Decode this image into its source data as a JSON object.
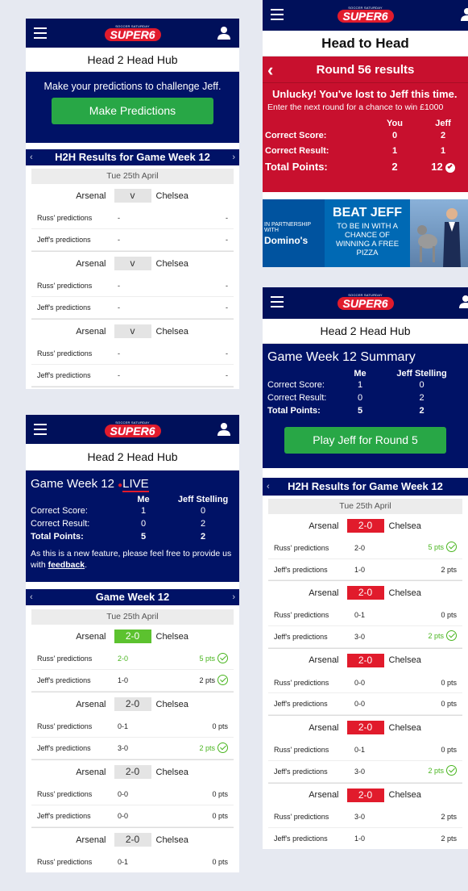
{
  "logo": {
    "small": "SOCCER SATURDAY",
    "big": "SUPER6"
  },
  "colors": {
    "navy": "#00105a",
    "red": "#e11b2c",
    "green": "#28a746",
    "win": "#5cc22f"
  },
  "icons": {
    "menu": "hamburger-menu-icon",
    "user": "user-icon",
    "back": "chevron-left-icon",
    "next": "chevron-right-icon",
    "check": "check-circle-icon"
  },
  "s1": {
    "title": "Head 2 Head Hub",
    "message": "Make your predictions to challenge Jeff.",
    "button": "Make Predictions",
    "bar": "H2H Results for Game Week 12",
    "date": "Tue 25th April",
    "matches": [
      {
        "home": "Arsenal",
        "score": "v",
        "away": "Chelsea",
        "rows": [
          {
            "name": "Russ' predictions",
            "score": "-",
            "pts": "-"
          },
          {
            "name": "Jeff's predictions",
            "score": "-",
            "pts": "-"
          }
        ]
      },
      {
        "home": "Arsenal",
        "score": "v",
        "away": "Chelsea",
        "rows": [
          {
            "name": "Russ' predictions",
            "score": "-",
            "pts": "-"
          },
          {
            "name": "Jeff's predictions",
            "score": "-",
            "pts": "-"
          }
        ]
      },
      {
        "home": "Arsenal",
        "score": "v",
        "away": "Chelsea",
        "rows": [
          {
            "name": "Russ' predictions",
            "score": "-",
            "pts": "-"
          },
          {
            "name": "Jeff's predictions",
            "score": "-",
            "pts": "-"
          }
        ]
      }
    ]
  },
  "s2": {
    "title": "Head 2 Head Hub",
    "gw": "Game Week 12",
    "live": "LIVE",
    "colMe": "Me",
    "colJeff": "Jeff Stelling",
    "rows": [
      {
        "label": "Correct Score:",
        "me": "1",
        "jeff": "0"
      },
      {
        "label": "Correct Result:",
        "me": "0",
        "jeff": "2"
      },
      {
        "label": "Total Points:",
        "me": "5",
        "jeff": "2"
      }
    ],
    "note": "As this is a new feature, please feel free to provide us with",
    "feedback": "feedback",
    "bar": "Game Week 12",
    "date": "Tue 25th April",
    "matches": [
      {
        "home": "Arsenal",
        "score": "2-0",
        "away": "Chelsea",
        "rows": [
          {
            "name": "Russ' predictions",
            "score": "2-0",
            "pts": "5 pts",
            "win": true
          },
          {
            "name": "Jeff's predictions",
            "score": "1-0",
            "pts": "2 pts",
            "win": false,
            "check": true
          }
        ]
      },
      {
        "home": "Arsenal",
        "score": "2-0",
        "away": "Chelsea",
        "rows": [
          {
            "name": "Russ' predictions",
            "score": "0-1",
            "pts": "0 pts"
          },
          {
            "name": "Jeff's predictions",
            "score": "3-0",
            "pts": "2 pts",
            "win": true
          }
        ]
      },
      {
        "home": "Arsenal",
        "score": "2-0",
        "away": "Chelsea",
        "rows": [
          {
            "name": "Russ' predictions",
            "score": "0-0",
            "pts": "0 pts"
          },
          {
            "name": "Jeff's predictions",
            "score": "0-0",
            "pts": "0 pts"
          }
        ]
      },
      {
        "home": "Arsenal",
        "score": "2-0",
        "away": "Chelsea",
        "rows": [
          {
            "name": "Russ' predictions",
            "score": "0-1",
            "pts": "0 pts"
          }
        ]
      }
    ]
  },
  "s3": {
    "title": "Head to Head",
    "round": "Round 56 results",
    "unlucky": "Unlucky! You've lost to Jeff this time.",
    "next": "Enter the next round for a chance to win £1000",
    "colYou": "You",
    "colJeff": "Jeff",
    "rows": [
      {
        "label": "Correct Score:",
        "you": "0",
        "jeff": "2"
      },
      {
        "label": "Correct Result:",
        "you": "1",
        "jeff": "1"
      },
      {
        "label": "Total Points:",
        "you": "2",
        "jeff": "12"
      }
    ],
    "banner": {
      "partner1": "IN PARTNERSHIP",
      "partner2": "WITH",
      "brand": "Domino's",
      "beat": "BEAT JEFF",
      "l1": "TO BE IN WITH A",
      "l2": "CHANCE OF",
      "l3": "WINNING A FREE",
      "l4": "PIZZA"
    }
  },
  "s4": {
    "title": "Head 2 Head Hub",
    "summary": "Game Week 12 Summary",
    "colMe": "Me",
    "colJeff": "Jeff Stelling",
    "rows": [
      {
        "label": "Correct Score:",
        "me": "1",
        "jeff": "0"
      },
      {
        "label": "Correct Result:",
        "me": "0",
        "jeff": "2"
      },
      {
        "label": "Total Points:",
        "me": "5",
        "jeff": "2"
      }
    ],
    "button": "Play Jeff for Round 5",
    "bar": "H2H Results for Game Week 12",
    "date": "Tue 25th April",
    "matches": [
      {
        "home": "Arsenal",
        "score": "2-0",
        "away": "Chelsea",
        "rows": [
          {
            "name": "Russ' predictions",
            "score": "2-0",
            "pts": "5 pts",
            "win": true
          },
          {
            "name": "Jeff's predictions",
            "score": "1-0",
            "pts": "2 pts"
          }
        ]
      },
      {
        "home": "Arsenal",
        "score": "2-0",
        "away": "Chelsea",
        "rows": [
          {
            "name": "Russ' predictions",
            "score": "0-1",
            "pts": "0 pts"
          },
          {
            "name": "Jeff's predictions",
            "score": "3-0",
            "pts": "2 pts",
            "win": true
          }
        ]
      },
      {
        "home": "Arsenal",
        "score": "2-0",
        "away": "Chelsea",
        "rows": [
          {
            "name": "Russ' predictions",
            "score": "0-0",
            "pts": "0 pts"
          },
          {
            "name": "Jeff's predictions",
            "score": "0-0",
            "pts": "0 pts"
          }
        ]
      },
      {
        "home": "Arsenal",
        "score": "2-0",
        "away": "Chelsea",
        "rows": [
          {
            "name": "Russ' predictions",
            "score": "0-1",
            "pts": "0 pts"
          },
          {
            "name": "Jeff's predictions",
            "score": "3-0",
            "pts": "2 pts",
            "win": true
          }
        ]
      },
      {
        "home": "Arsenal",
        "score": "2-0",
        "away": "Chelsea",
        "rows": [
          {
            "name": "Russ' predictions",
            "score": "3-0",
            "pts": "2 pts"
          },
          {
            "name": "Jeff's predictions",
            "score": "1-0",
            "pts": "2 pts"
          }
        ]
      }
    ]
  }
}
